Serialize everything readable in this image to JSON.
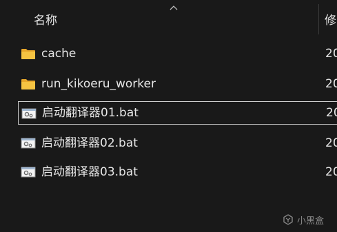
{
  "header": {
    "name_col": "名称",
    "modified_col": "修",
    "sort_arrow_icon": "chevron-up-icon"
  },
  "files": [
    {
      "name": "cache",
      "type": "folder",
      "date": "20"
    },
    {
      "name": "run_kikoeru_worker",
      "type": "folder",
      "date": "20"
    },
    {
      "name": "启动翻译器01.bat",
      "type": "batch-file",
      "date": "20",
      "selected": true
    },
    {
      "name": "启动翻译器02.bat",
      "type": "batch-file",
      "date": "20"
    },
    {
      "name": "启动翻译器03.bat",
      "type": "batch-file",
      "date": "20"
    }
  ],
  "watermark": {
    "text": "小黑盒"
  },
  "colors": {
    "background": "#191919",
    "text": "#e6e6e6",
    "folder": "#f5c342",
    "selection_border": "#cfcfcf"
  }
}
